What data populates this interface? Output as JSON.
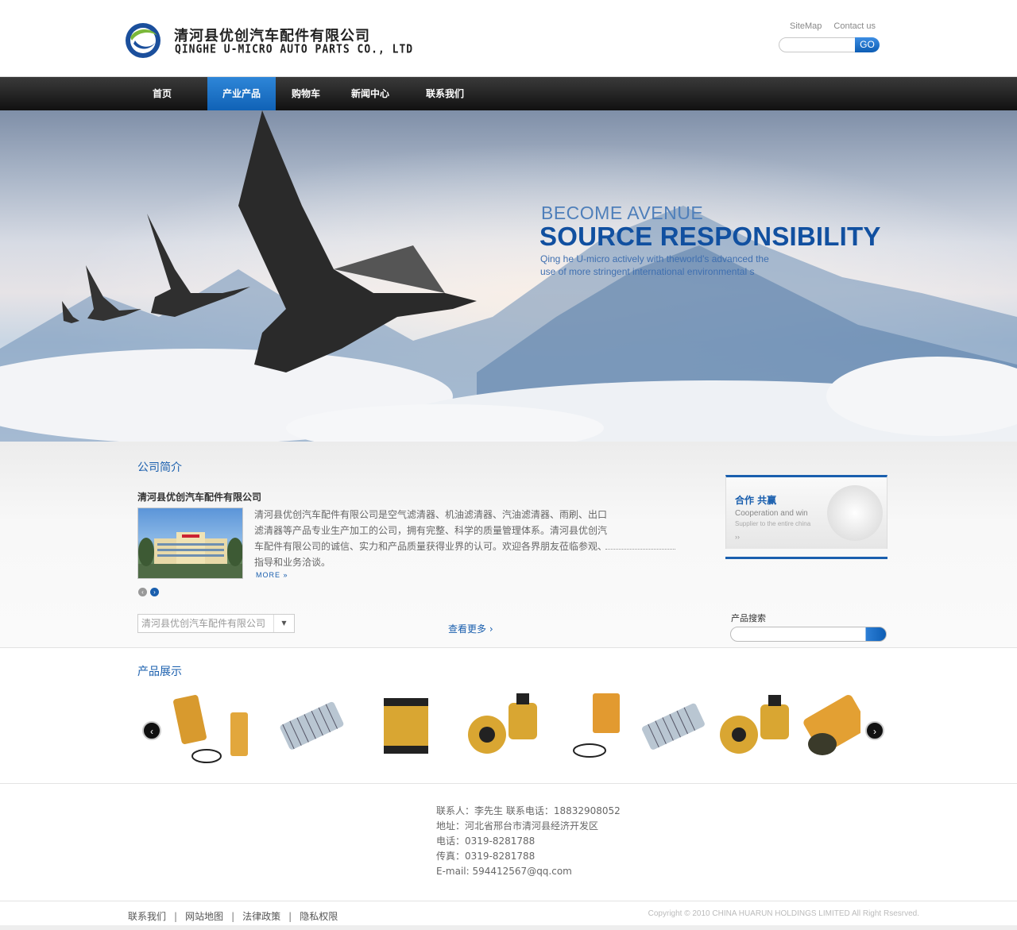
{
  "header": {
    "brand_cn": "清河县优创汽车配件有限公司",
    "brand_en": "QINGHE U-MICRO AUTO PARTS CO., LTD",
    "links": [
      "SiteMap",
      "Contact us"
    ],
    "search_button": "GO"
  },
  "nav": {
    "items": [
      "首页",
      "产业产品",
      "购物车",
      "新闻中心",
      "联系我们"
    ],
    "active_index": 1
  },
  "banner": {
    "line1": "BECOME AVENUE",
    "line2": "SOURCE RESPONSIBILITY",
    "line3": "Qing he U-micro actively with theworld's advanced the use of more stringent international environmental s"
  },
  "intro": {
    "section_title": "公司简介",
    "company_name": "清河县优创汽车配件有限公司",
    "description": "清河县优创汽车配件有限公司是空气滤清器、机油滤清器、汽油滤清器、雨刷、出口滤清器等产品专业生产加工的公司，拥有完整、科学的质量管理体系。清河县优创汽车配件有限公司的诚信、实力和产品质量获得业界的认可。欢迎各界朋友莅临参观、指导和业务洽谈。",
    "more": "MORE",
    "select_value": "清河县优创汽车配件有限公司",
    "view_more": "查看更多"
  },
  "coop": {
    "title": "合作 共赢",
    "en": "Cooperation and win",
    "sub": "Supplier to the entire china",
    "arrow": "››"
  },
  "product_search": {
    "label": "产品搜索"
  },
  "products": {
    "section_title": "产品展示",
    "prev": "‹",
    "next": "›"
  },
  "contact": {
    "line1": "联系人：李先生  联系电话：18832908052",
    "line2": "地址：河北省邢台市清河县经济开发区",
    "line3": "电话：0319-8281788",
    "line4": "传真：0319-8281788",
    "line5": "E-mail: 594412567@qq.com"
  },
  "footer": {
    "links": [
      "联系我们",
      "网站地图",
      "法律政策",
      "隐私权限"
    ],
    "separator": "|",
    "copyright": "Copyright © 2010 CHINA HUARUN HOLDINGS LIMITED All Right Rsesrved."
  },
  "colors": {
    "accent": "#1a5fae",
    "nav_bg": "#1e1e1e",
    "nav_active": "#1f74c8"
  }
}
